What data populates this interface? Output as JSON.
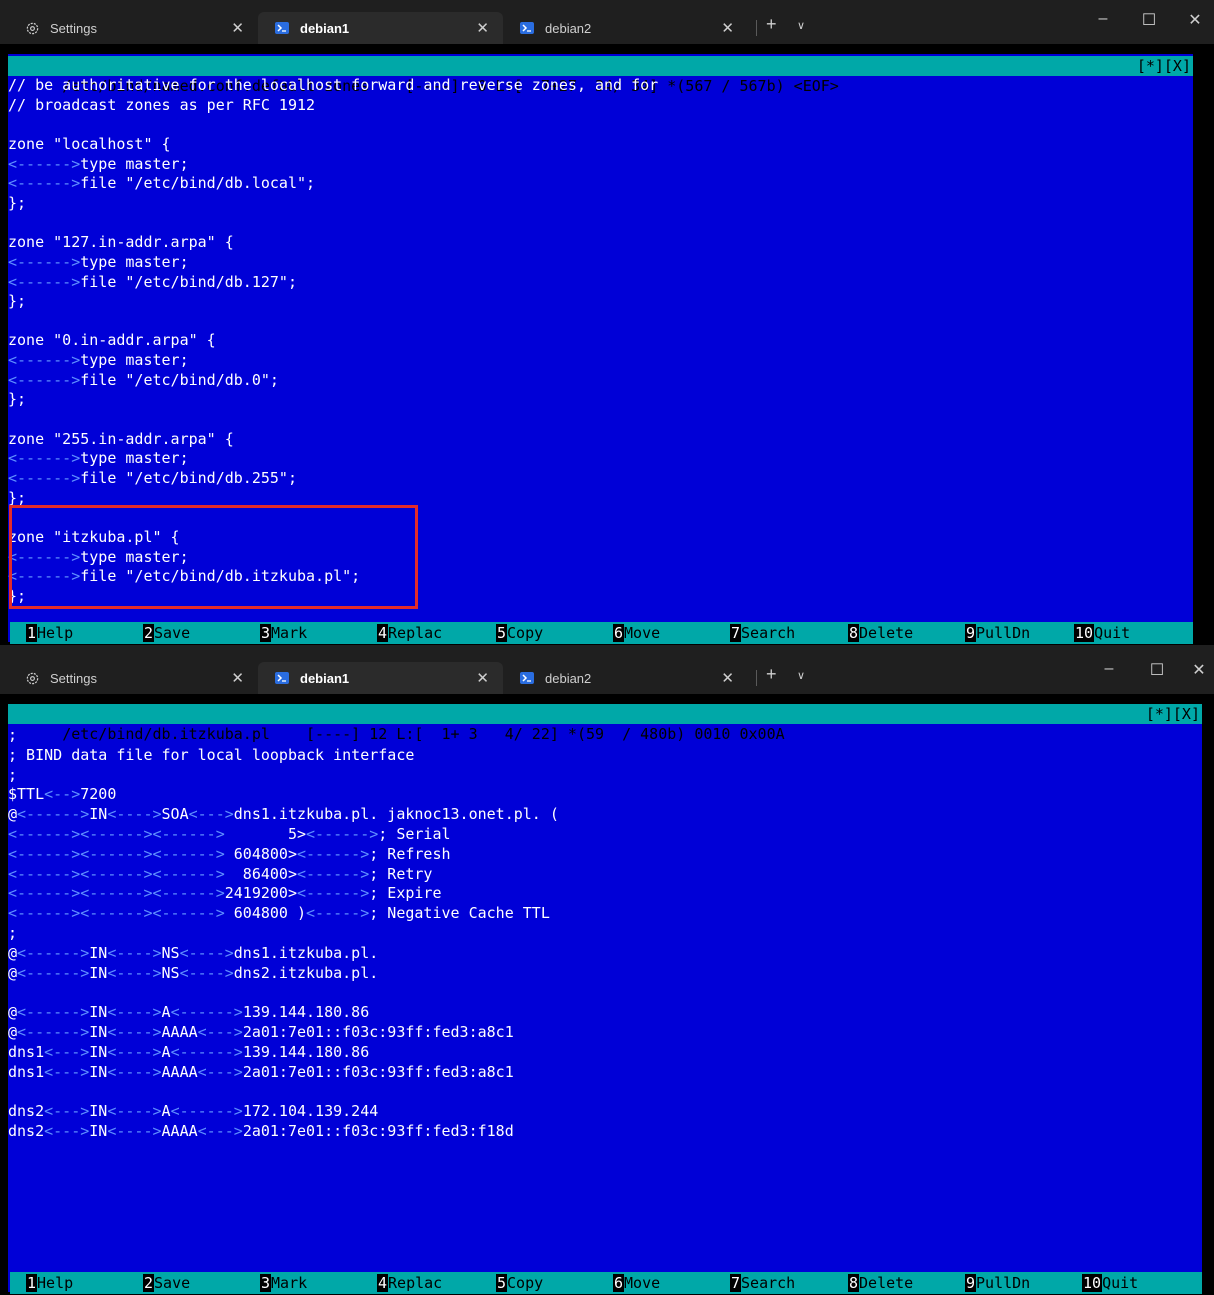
{
  "windows": [
    {
      "tabs": [
        {
          "label": "Settings",
          "icon": "gear-icon",
          "active": false
        },
        {
          "label": "debian1",
          "icon": "terminal-icon",
          "active": true
        },
        {
          "label": "debian2",
          "icon": "terminal-icon",
          "active": false
        }
      ],
      "new_tab": "+",
      "controls": {
        "minimize": "–",
        "maximize": "☐",
        "close": "✕"
      },
      "status_left": "/etc/bind/named.conf.default-zones    [----]  0 L:[  7+27  34/ 34] *(567 / 567b) <EOF>",
      "status_right": "[*][X]",
      "lines": [
        "// be authoritative for the localhost forward and reverse zones, and for",
        "// broadcast zones as per RFC 1912",
        "",
        "zone \"localhost\" {",
        "<------>type master;",
        "<------>file \"/etc/bind/db.local\";",
        "};",
        "",
        "zone \"127.in-addr.arpa\" {",
        "<------>type master;",
        "<------>file \"/etc/bind/db.127\";",
        "};",
        "",
        "zone \"0.in-addr.arpa\" {",
        "<------>type master;",
        "<------>file \"/etc/bind/db.0\";",
        "};",
        "",
        "zone \"255.in-addr.arpa\" {",
        "<------>type master;",
        "<------>file \"/etc/bind/db.255\";",
        "};",
        "",
        "zone \"itzkuba.pl\" {",
        "<------>type master;",
        "<------>file \"/etc/bind/db.itzkuba.pl\";",
        "};"
      ],
      "fkeys": [
        {
          "num": "1",
          "label": "Help"
        },
        {
          "num": "2",
          "label": "Save"
        },
        {
          "num": "3",
          "label": "Mark"
        },
        {
          "num": "4",
          "label": "Replac"
        },
        {
          "num": "5",
          "label": "Copy"
        },
        {
          "num": "6",
          "label": "Move"
        },
        {
          "num": "7",
          "label": "Search"
        },
        {
          "num": "8",
          "label": "Delete"
        },
        {
          "num": "9",
          "label": "PullDn"
        },
        {
          "num": "10",
          "label": "Quit"
        }
      ]
    },
    {
      "tabs": [
        {
          "label": "Settings",
          "icon": "gear-icon",
          "active": false
        },
        {
          "label": "debian1",
          "icon": "terminal-icon",
          "active": true
        },
        {
          "label": "debian2",
          "icon": "terminal-icon",
          "active": false
        }
      ],
      "new_tab": "+",
      "controls": {
        "minimize": "–",
        "maximize": "☐",
        "close": "✕"
      },
      "status_left": "/etc/bind/db.itzkuba.pl    [----] 12 L:[  1+ 3   4/ 22] *(59  / 480b) 0010 0x00A",
      "status_right": "[*][X]",
      "lines": [
        ";",
        "; BIND data file for local loopback interface",
        ";",
        "$TTL<-->7200",
        "@<------>IN<---->SOA<--->dns1.itzkuba.pl. jaknoc13.onet.pl. (",
        "<------><------><------>       5><------>; Serial",
        "<------><------><------> 604800><------>; Refresh",
        "<------><------><------>  86400><------>; Retry",
        "<------><------><------>2419200><------>; Expire",
        "<------><------><------> 604800 )<----->; Negative Cache TTL",
        ";",
        "@<------>IN<---->NS<---->dns1.itzkuba.pl.",
        "@<------>IN<---->NS<---->dns2.itzkuba.pl.",
        "",
        "@<------>IN<---->A<------>139.144.180.86",
        "@<------>IN<---->AAAA<--->2a01:7e01::f03c:93ff:fed3:a8c1",
        "dns1<--->IN<---->A<------>139.144.180.86",
        "dns1<--->IN<---->AAAA<--->2a01:7e01::f03c:93ff:fed3:a8c1",
        "",
        "dns2<--->IN<---->A<------>172.104.139.244",
        "dns2<--->IN<---->AAAA<--->2a01:7e01::f03c:93ff:fed3:f18d"
      ],
      "fkeys": [
        {
          "num": "1",
          "label": "Help"
        },
        {
          "num": "2",
          "label": "Save"
        },
        {
          "num": "3",
          "label": "Mark"
        },
        {
          "num": "4",
          "label": "Replac"
        },
        {
          "num": "5",
          "label": "Copy"
        },
        {
          "num": "6",
          "label": "Move"
        },
        {
          "num": "7",
          "label": "Search"
        },
        {
          "num": "8",
          "label": "Delete"
        },
        {
          "num": "9",
          "label": "PullDn"
        },
        {
          "num": "10",
          "label": "Quit"
        }
      ]
    }
  ],
  "colors": {
    "terminal_bg": "#0000d7",
    "status_bg": "#00a8a8",
    "highlight_box": "#e22b2b",
    "tab_arrow": "#5f8fff"
  }
}
